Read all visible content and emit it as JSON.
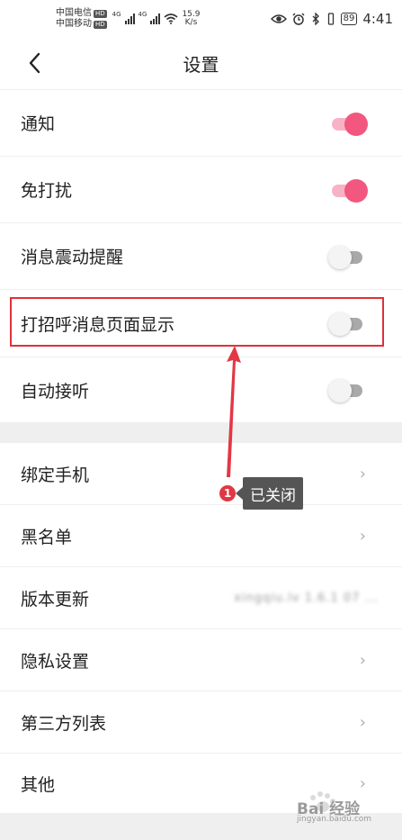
{
  "status_bar": {
    "carrier_1": "中国电信",
    "carrier_2": "中国移动",
    "hd_label": "HD",
    "network_1": "4G",
    "network_2": "4G",
    "speed_value": "15.9",
    "speed_unit": "K/s",
    "battery": "89",
    "time": "4:41"
  },
  "nav": {
    "title": "设置"
  },
  "settings_toggles": [
    {
      "label": "通知",
      "state": "on"
    },
    {
      "label": "免打扰",
      "state": "on"
    },
    {
      "label": "消息震动提醒",
      "state": "off"
    },
    {
      "label": "打招呼消息页面显示",
      "state": "off"
    },
    {
      "label": "自动接听",
      "state": "off"
    }
  ],
  "settings_links": [
    {
      "label": "绑定手机"
    },
    {
      "label": "黑名单"
    },
    {
      "label": "版本更新",
      "value": "xingqiu.lv 1.6.1 07 ..."
    },
    {
      "label": "隐私设置"
    },
    {
      "label": "第三方列表"
    },
    {
      "label": "其他"
    }
  ],
  "annotation": {
    "step_number": "1",
    "callout_text": "已关闭",
    "highlight_color": "#e0303a"
  },
  "watermark": {
    "brand": "Bai 经验",
    "url": "jingyan.baidu.com"
  },
  "colors": {
    "toggle_on": "#f2577f",
    "toggle_off_track": "#a9a9a9",
    "section_gap": "#efefef"
  }
}
